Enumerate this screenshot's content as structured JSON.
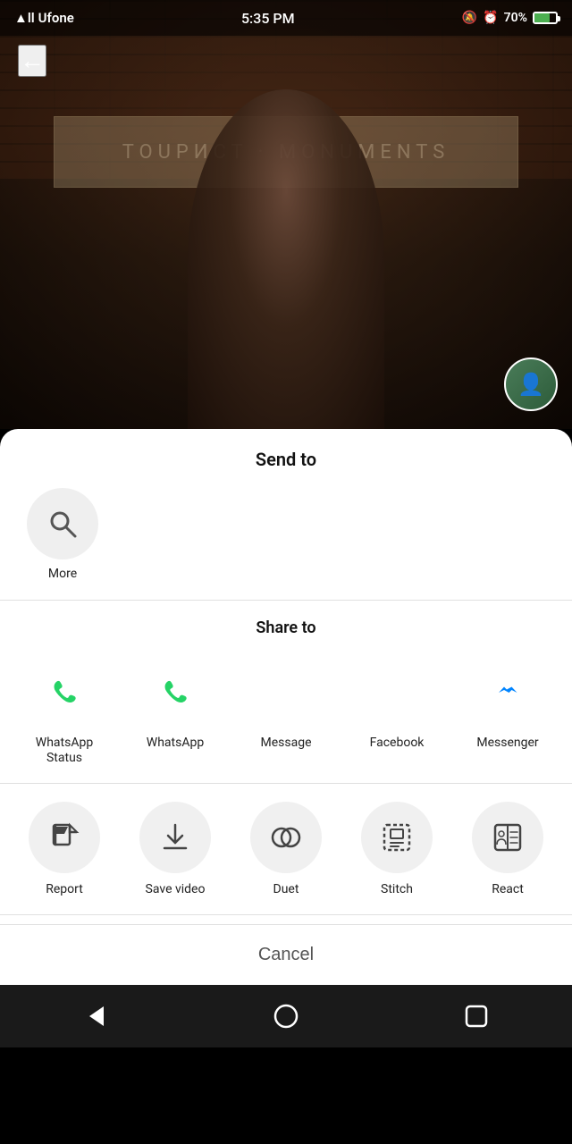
{
  "statusBar": {
    "carrier": "Ufone",
    "time": "5:35 PM",
    "battery": "70%",
    "signal": "▲ll"
  },
  "video": {
    "backLabel": "←"
  },
  "sheet": {
    "title": "Send to",
    "moreLabel": "More",
    "searchIcon": "🔍",
    "shareTo": "Share to",
    "shareApps": [
      {
        "id": "whatsapp-status",
        "label": "WhatsApp Status",
        "color": "whatsapp-green"
      },
      {
        "id": "whatsapp",
        "label": "WhatsApp",
        "color": "whatsapp-green"
      },
      {
        "id": "message",
        "label": "Message",
        "color": "message-red"
      },
      {
        "id": "facebook",
        "label": "Facebook",
        "color": "facebook-blue"
      },
      {
        "id": "messenger",
        "label": "Messenger",
        "color": "messenger-blue"
      }
    ],
    "actions": [
      {
        "id": "report",
        "label": "Report"
      },
      {
        "id": "save-video",
        "label": "Save video"
      },
      {
        "id": "duet",
        "label": "Duet"
      },
      {
        "id": "stitch",
        "label": "Stitch"
      },
      {
        "id": "react",
        "label": "React"
      }
    ],
    "cancelLabel": "Cancel"
  },
  "navBar": {
    "backIcon": "◁",
    "homeIcon": "○",
    "recentIcon": "□"
  }
}
